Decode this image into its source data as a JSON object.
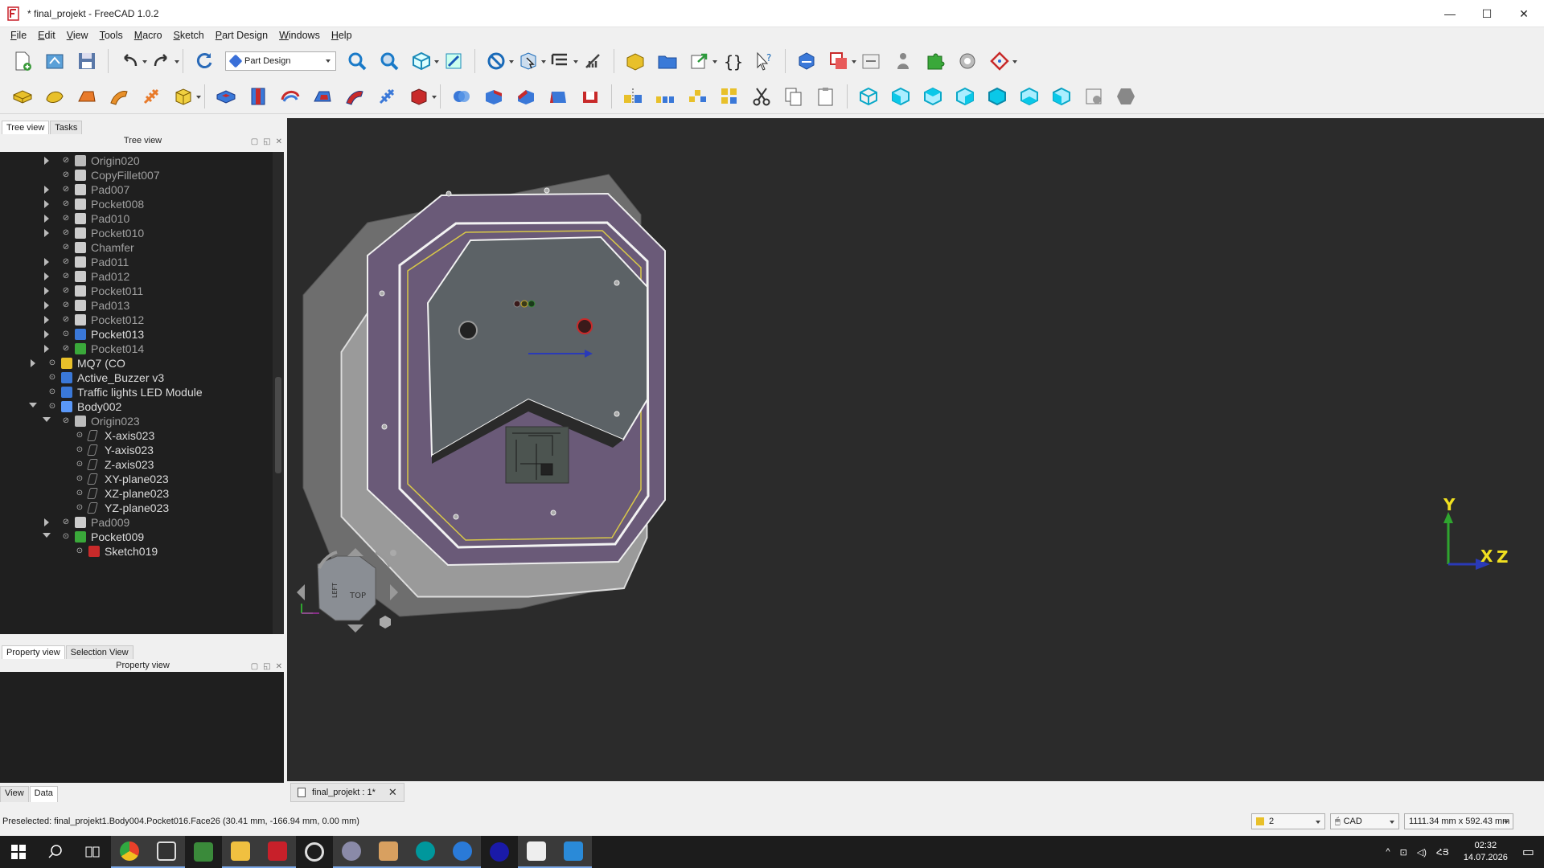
{
  "window": {
    "title": "* final_projekt - FreeCAD 1.0.2",
    "minimize": "—",
    "maximize": "☐",
    "close": "✕"
  },
  "menu": [
    {
      "label": "File",
      "ul": "F",
      "rest": "ile"
    },
    {
      "label": "Edit",
      "ul": "E",
      "rest": "dit"
    },
    {
      "label": "View",
      "ul": "V",
      "rest": "iew"
    },
    {
      "label": "Tools",
      "ul": "T",
      "rest": "ools"
    },
    {
      "label": "Macro",
      "ul": "M",
      "rest": "acro"
    },
    {
      "label": "Sketch",
      "ul": "S",
      "rest": "ketch"
    },
    {
      "label": "Part Design",
      "ul": "P",
      "rest": "art Design"
    },
    {
      "label": "Windows",
      "ul": "W",
      "rest": "indows"
    },
    {
      "label": "Help",
      "ul": "H",
      "rest": "elp"
    }
  ],
  "workbench_selector": {
    "value": "Part Design"
  },
  "left_panel": {
    "tabs": [
      "Tree view",
      "Tasks"
    ],
    "header": "Tree view",
    "tree": [
      {
        "label": "Origin020",
        "indent": 2,
        "arrow": "right",
        "eye": "hidden",
        "icon": "origin-icon",
        "dim": true
      },
      {
        "label": "CopyFillet007",
        "indent": 2,
        "arrow": "none",
        "eye": "hidden",
        "icon": "feature-icon",
        "dim": true
      },
      {
        "label": "Pad007",
        "indent": 2,
        "arrow": "right",
        "eye": "hidden",
        "icon": "pad-icon",
        "dim": true
      },
      {
        "label": "Pocket008",
        "indent": 2,
        "arrow": "right",
        "eye": "hidden",
        "icon": "pocket-icon",
        "dim": true
      },
      {
        "label": "Pad010",
        "indent": 2,
        "arrow": "right",
        "eye": "hidden",
        "icon": "pad-icon",
        "dim": true
      },
      {
        "label": "Pocket010",
        "indent": 2,
        "arrow": "right",
        "eye": "hidden",
        "icon": "pocket-icon",
        "dim": true
      },
      {
        "label": "Chamfer",
        "indent": 2,
        "arrow": "none",
        "eye": "hidden",
        "icon": "chamfer-icon",
        "dim": true
      },
      {
        "label": "Pad011",
        "indent": 2,
        "arrow": "right",
        "eye": "hidden",
        "icon": "pad-icon",
        "dim": true
      },
      {
        "label": "Pad012",
        "indent": 2,
        "arrow": "right",
        "eye": "hidden",
        "icon": "pad-icon",
        "dim": true
      },
      {
        "label": "Pocket011",
        "indent": 2,
        "arrow": "right",
        "eye": "hidden",
        "icon": "pocket-icon",
        "dim": true
      },
      {
        "label": "Pad013",
        "indent": 2,
        "arrow": "right",
        "eye": "hidden",
        "icon": "pad-icon",
        "dim": true
      },
      {
        "label": "Pocket012",
        "indent": 2,
        "arrow": "right",
        "eye": "hidden",
        "icon": "pocket-icon",
        "dim": true
      },
      {
        "label": "Pocket013",
        "indent": 2,
        "arrow": "right",
        "eye": "visible",
        "icon": "pocket-blue-icon",
        "dim": false
      },
      {
        "label": "Pocket014",
        "indent": 2,
        "arrow": "right",
        "eye": "hidden",
        "icon": "pocket-green-icon",
        "dim": true
      },
      {
        "label": "MQ7 (CO",
        "indent": 1,
        "arrow": "right",
        "eye": "visible",
        "icon": "part-yellow-icon",
        "dim": false
      },
      {
        "label": "Active_Buzzer v3",
        "indent": 1,
        "arrow": "none",
        "eye": "visible",
        "icon": "body-blue-icon",
        "dim": false
      },
      {
        "label": "Traffic lights LED Module",
        "indent": 1,
        "arrow": "none",
        "eye": "visible",
        "icon": "body-blue-icon",
        "dim": false
      },
      {
        "label": "Body002",
        "indent": 1,
        "arrow": "down",
        "eye": "visible",
        "icon": "body-active-icon",
        "dim": false
      },
      {
        "label": "Origin023",
        "indent": 2,
        "arrow": "down",
        "eye": "hidden",
        "icon": "origin-icon",
        "dim": true
      },
      {
        "label": "X-axis023",
        "indent": 3,
        "arrow": "none",
        "eye": "visible",
        "icon": "axis-icon",
        "dim": false
      },
      {
        "label": "Y-axis023",
        "indent": 3,
        "arrow": "none",
        "eye": "visible",
        "icon": "axis-icon",
        "dim": false
      },
      {
        "label": "Z-axis023",
        "indent": 3,
        "arrow": "none",
        "eye": "visible",
        "icon": "axis-icon",
        "dim": false
      },
      {
        "label": "XY-plane023",
        "indent": 3,
        "arrow": "none",
        "eye": "visible",
        "icon": "plane-icon",
        "dim": false
      },
      {
        "label": "XZ-plane023",
        "indent": 3,
        "arrow": "none",
        "eye": "visible",
        "icon": "plane-icon",
        "dim": false
      },
      {
        "label": "YZ-plane023",
        "indent": 3,
        "arrow": "none",
        "eye": "visible",
        "icon": "plane-icon",
        "dim": false
      },
      {
        "label": "Pad009",
        "indent": 2,
        "arrow": "right",
        "eye": "hidden",
        "icon": "pad-icon",
        "dim": true
      },
      {
        "label": "Pocket009",
        "indent": 2,
        "arrow": "down",
        "eye": "visible",
        "icon": "pocket-green-icon",
        "dim": false
      },
      {
        "label": "Sketch019",
        "indent": 3,
        "arrow": "none",
        "eye": "visible",
        "icon": "sketch-icon",
        "dim": false
      }
    ]
  },
  "property_panel": {
    "tabs": [
      "Property view",
      "Selection View"
    ],
    "header": "Property view",
    "bottom_tabs": [
      "View",
      "Data"
    ]
  },
  "document_tab": {
    "label": "final_projekt : 1*",
    "close": "✕"
  },
  "navcube": {
    "top_face": "TOP",
    "left_face": "LEFT"
  },
  "axis_indicator": {
    "y": "Y",
    "x": "X",
    "z": "Z"
  },
  "status": {
    "text": "Preselected: final_projekt1.Body004.Pocket016.Face26 (30.41 mm, -166.94 mm, 0.00 mm)",
    "layer": "2",
    "nav_style": "CAD",
    "dimensions": "1111.34 mm x 592.43 mm"
  },
  "taskbar": {
    "apps": [
      "windows-start-icon",
      "search-icon",
      "task-view-icon",
      "chrome-icon",
      "inkscape-icon",
      "app-icon",
      "file-explorer-icon",
      "freecad-icon",
      "settings-icon",
      "app2-icon",
      "app3-icon",
      "arduino-icon",
      "app4-icon",
      "app5-icon",
      "app6-icon",
      "vscode-icon"
    ],
    "lang": "ՀՅ",
    "time": "02:32",
    "date": "14.07.2026"
  },
  "colors": {
    "view_bg": "#2b2b2b",
    "case_purple": "#6a5a78",
    "case_grey": "#6e6e6e",
    "lid_grey": "#5c6266",
    "y_axis": "#2fa52f",
    "axis_label": "#f0e020",
    "x_arrow": "#2a3ab8"
  }
}
